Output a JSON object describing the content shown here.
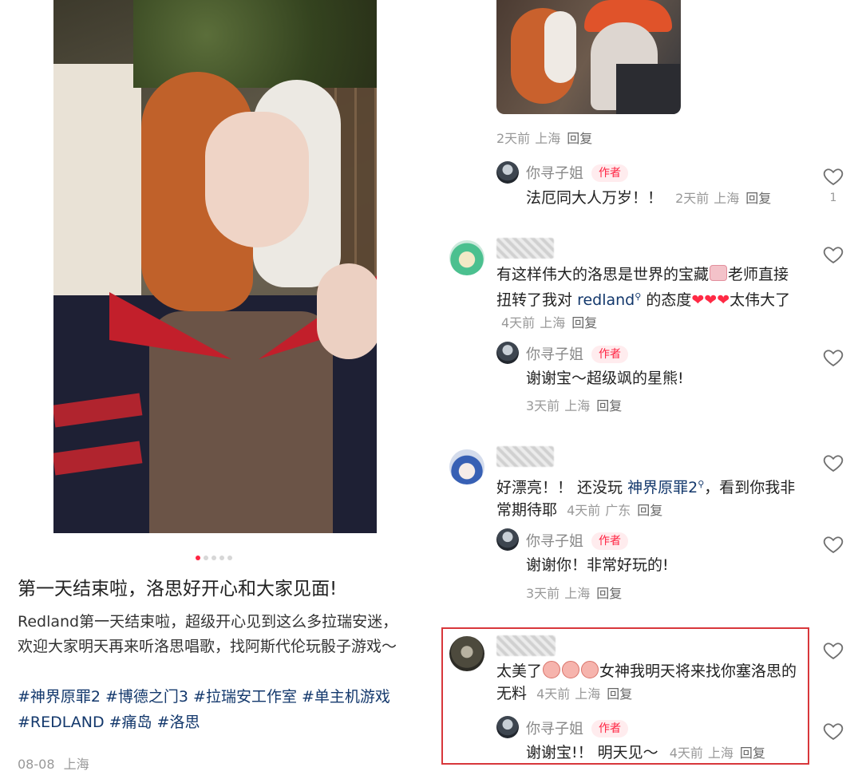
{
  "post": {
    "title": "第一天结束啦，洛思好开心和大家见面!",
    "body": "Redland第一天结束啦，超级开心见到这么多拉瑞安迷，欢迎大家明天再来听洛思唱歌，找阿斯代伦玩骰子游戏～",
    "tags": [
      "#神界原罪2",
      "#博德之门3",
      "#拉瑞安工作室",
      "#单主机游戏",
      "#REDLAND",
      "#痛岛",
      "#洛思"
    ],
    "date": "08-08",
    "location": "上海",
    "carousel": {
      "count": 5,
      "active_index": 0
    }
  },
  "common": {
    "reply_label": "回复",
    "author_name": "你寻子姐",
    "author_badge": "作者"
  },
  "comments": [
    {
      "image_comment_meta": {
        "time": "2天前",
        "location": "上海"
      },
      "author_reply": {
        "text": "法厄同大人万岁！！",
        "time": "2天前",
        "location": "上海",
        "like_count": "1"
      }
    },
    {
      "text_before_emoji": "有这样伟大的洛思是世界的宝藏",
      "text_after_emoji": "老师直接扭转了我对",
      "link_text": "redland",
      "text_after_link": "的态度",
      "text_end": "太伟大了",
      "time": "4天前",
      "location": "上海",
      "author_reply": {
        "text": "谢谢宝～超级飒的星熊!",
        "time": "3天前",
        "location": "上海"
      }
    },
    {
      "text_before_link": "好漂亮！！ 还没玩",
      "link_text": "神界原罪2",
      "text_after_link": "，看到你我非常期待耶",
      "time": "4天前",
      "location": "广东",
      "author_reply": {
        "text": "谢谢你！非常好玩的!",
        "time": "3天前",
        "location": "上海"
      }
    },
    {
      "text_start": "太美了",
      "text_after_emoji": "女神我明天将来找你塞洛思的无料",
      "time": "4天前",
      "location": "上海",
      "author_reply": {
        "text": "谢谢宝!！ 明天见～",
        "time": "4天前",
        "location": "上海"
      }
    }
  ],
  "colors": {
    "accent": "#ff2442",
    "tag_link": "#13386c",
    "highlight_box": "#d8373b",
    "meta_gray": "#999999"
  },
  "icons": [
    "heart-outline-icon",
    "search-link-icon",
    "red-heart-emoji",
    "shy-face-emoji",
    "cake-emoji"
  ]
}
